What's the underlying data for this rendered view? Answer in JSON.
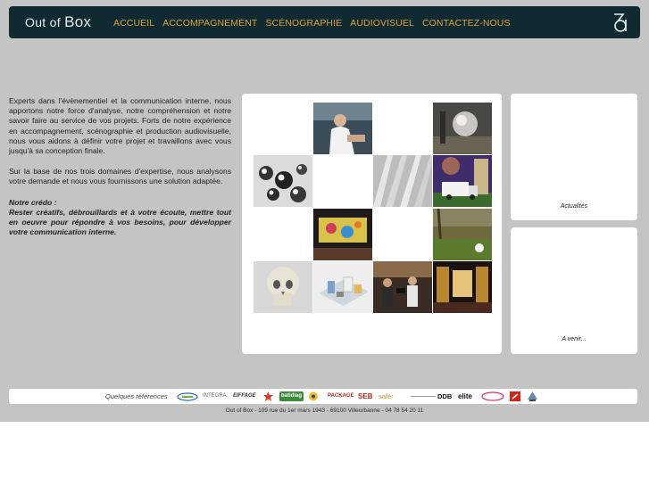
{
  "header": {
    "logo_prefix": "Out of ",
    "logo_b": "Box",
    "nav": [
      "ACCUEIL",
      "ACCOMPAGNEMENT",
      "SCÉNOGRAPHIE",
      "AUDIOVISUEL",
      "CONTACTEZ-NOUS"
    ],
    "accent_color": "#e0a33a",
    "bar_color": "#0f2a30"
  },
  "intro": {
    "p1": "Experts dans l'évènementiel et la communication interne, nous apportons notre force d'analyse, notre compréhension et notre savoir faire au service de vos projets. Forts de notre expérience en accompagnement, scénographie et production audiovisuelle, nous vous aidons à définir votre projet et travaillons avec vous jusqu'à sa conception finale.",
    "p2": "Sur la base de nos trois domaines d'expertise, nous analysons votre demande et nous vous fournissons une solution adaptée.",
    "credo_title": "Notre crédo :",
    "credo_text": "Rester créatifs, débrouillards et à votre écoute, mettre tout en oeuvre pour répondre à vos besoins, pour développer votre communication interne."
  },
  "gallery": {
    "tiles": [
      {
        "name": "chef-photo",
        "description": "photo"
      },
      {
        "name": "metal-sculpture-photo",
        "description": "photo"
      },
      {
        "name": "chrome-spheres-image",
        "description": "image"
      },
      {
        "name": "white-panels-image",
        "description": "image"
      },
      {
        "name": "truck-illustration",
        "description": "image"
      },
      {
        "name": "stage-screen-photo",
        "description": "photo"
      },
      {
        "name": "golf-ball-photo",
        "description": "photo"
      },
      {
        "name": "skull-image",
        "description": "image"
      },
      {
        "name": "exhibition-model-image",
        "description": "image"
      },
      {
        "name": "film-crew-photo",
        "description": "photo"
      },
      {
        "name": "theater-stage-photo",
        "description": "photo"
      }
    ]
  },
  "panels": {
    "news_label": "Actualités",
    "upcoming_label": "A venir..."
  },
  "references": {
    "label": "Quelques références",
    "clients": [
      "",
      "INTEGRA",
      "EIFFAGE",
      "",
      "batidiag",
      "",
      "PACKAGE",
      "SEB",
      "safer",
      "",
      "DDB",
      "elite",
      "",
      "",
      ""
    ]
  },
  "footer": {
    "address": "Out of Box - 109 rue du 1er mars 1943 - 69100 Villeurbanne - 04 78 54 20 11"
  }
}
